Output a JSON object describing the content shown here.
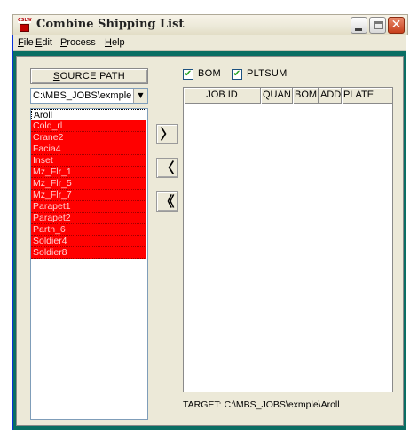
{
  "window": {
    "title": "Combine Shipping List",
    "icon_text": "CSLW"
  },
  "menu": [
    "File",
    "Edit",
    "Process",
    "Help"
  ],
  "source": {
    "button_label": "SOURCE PATH",
    "path_value": "C:\\MBS_JOBS\\exmple",
    "items": [
      {
        "label": "Aroll",
        "state": "selected"
      },
      {
        "label": "Cold_rl",
        "state": "error"
      },
      {
        "label": "Crane2",
        "state": "error"
      },
      {
        "label": "Facia4",
        "state": "error"
      },
      {
        "label": "Inset",
        "state": "error"
      },
      {
        "label": "Mz_Flr_1",
        "state": "error"
      },
      {
        "label": "Mz_Flr_5",
        "state": "error"
      },
      {
        "label": "Mz_Flr_7",
        "state": "error"
      },
      {
        "label": "Parapet1",
        "state": "error"
      },
      {
        "label": "Parapet2",
        "state": "error"
      },
      {
        "label": "Partn_6",
        "state": "error"
      },
      {
        "label": "Soldier4",
        "state": "error"
      },
      {
        "label": "Soldier8",
        "state": "error"
      }
    ]
  },
  "transfer_buttons": {
    "add": "〉",
    "remove": "〈",
    "remove_all": "《"
  },
  "options": {
    "bom": {
      "label": "BOM",
      "checked": true
    },
    "pltsum": {
      "label": "PLTSUM",
      "checked": true
    }
  },
  "grid": {
    "columns": [
      "JOB ID",
      "QUAN",
      "BOM",
      "ADD",
      "PLATE"
    ],
    "rows": []
  },
  "target": {
    "text": "TARGET: C:\\MBS_JOBS\\exmple\\Aroll"
  },
  "colors": {
    "window_frame": "#0a6e63",
    "error_row": "#ff0000",
    "dialog_face": "#ece9d8"
  },
  "icons": {
    "minimize": "minimize-icon",
    "maximize": "maximize-icon",
    "close": "close-icon",
    "dropdown": "chevron-down-icon"
  }
}
